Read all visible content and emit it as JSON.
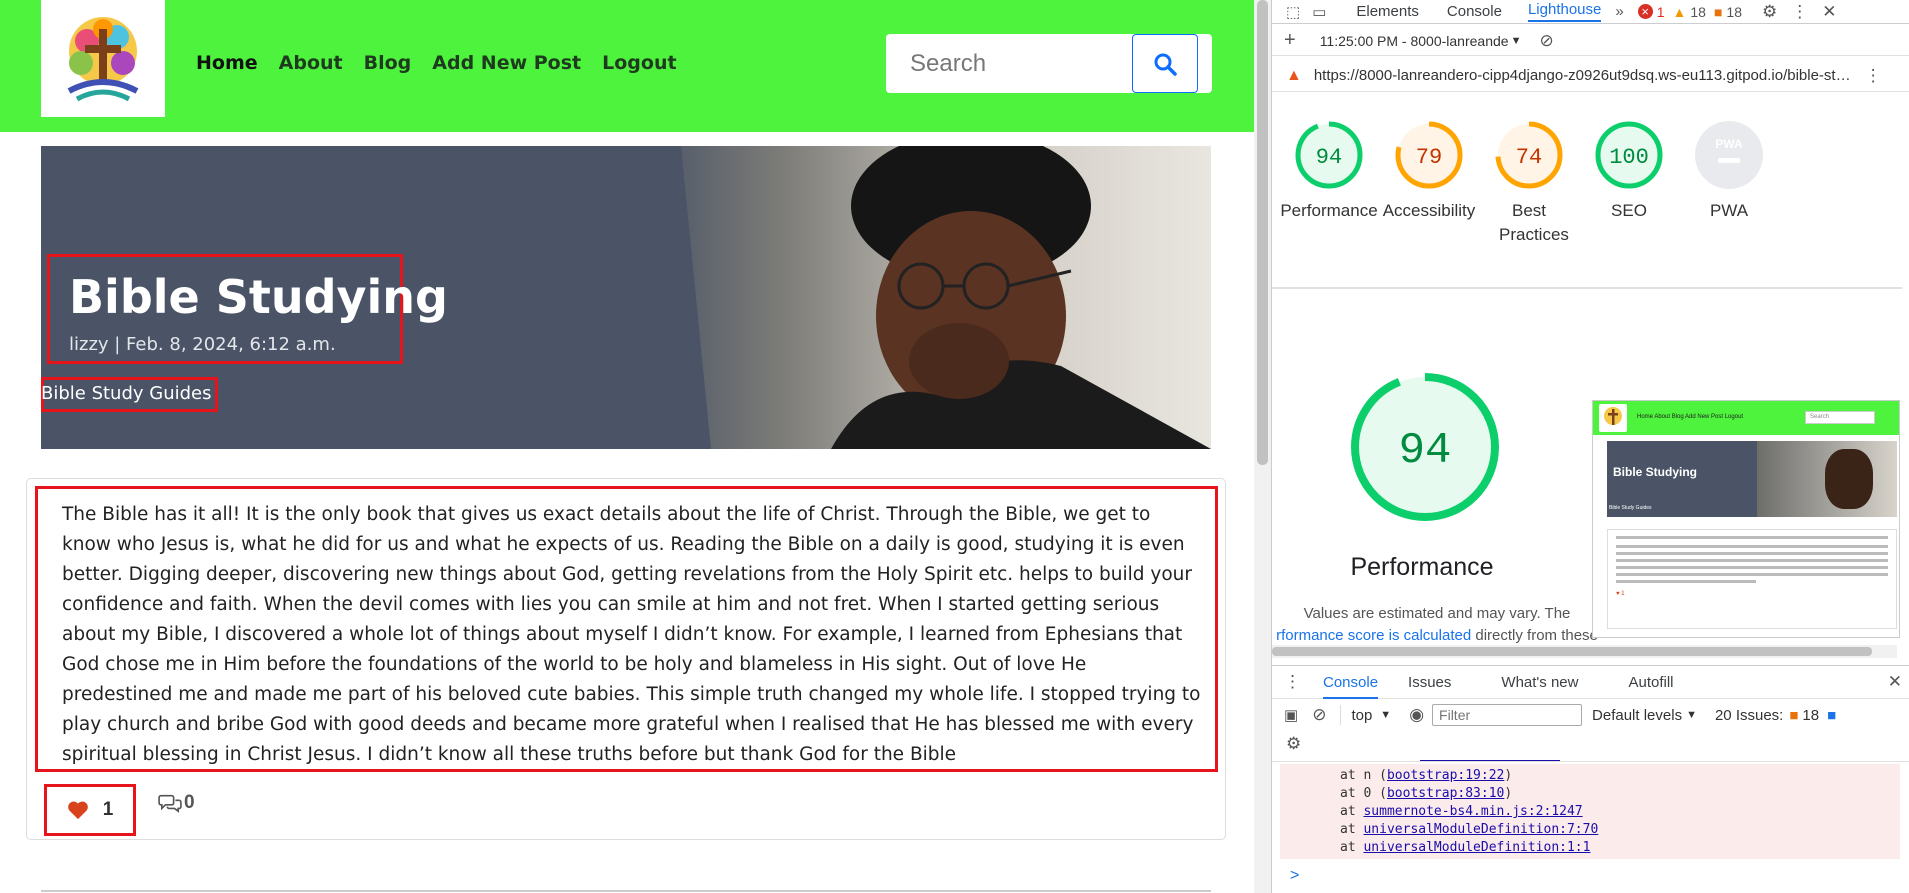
{
  "nav": {
    "items": [
      "Home",
      "About",
      "Blog",
      "Add New Post",
      "Logout"
    ]
  },
  "search": {
    "placeholder": "Search"
  },
  "hero": {
    "title": "Bible Studying",
    "meta": "lizzy | Feb. 8, 2024, 6:12 a.m.",
    "category": "Bible Study Guides"
  },
  "post": {
    "body": "The Bible has it all! It is the only book that gives us exact details about the life of Christ. Through the Bible, we get to know who Jesus is, what he did for us and what he expects of us. Reading the Bible on a daily is good, studying it is even better. Digging deeper, discovering new things about God, getting revelations from the Holy Spirit etc. helps to build your confidence and faith. When the devil comes with lies you can smile at him and not fret. When I started getting serious about my Bible, I discovered a whole lot of things about myself I didn’t know. For example, I learned from Ephesians that God chose me in Him before the foundations of the world to be holy and blameless in His sight. Out of love He predestined me and made me part of his beloved cute babies. This simple truth changed my whole life. I stopped trying to play church and bribe God with good deeds and became more grateful when I realised that He has blessed me with every spiritual blessing in Christ Jesus. I didn’t know all these truths before but thank God for the Bible",
    "likes": "1",
    "comments": "0"
  },
  "devtools": {
    "tabs": [
      "Elements",
      "Console",
      "Lighthouse"
    ],
    "active_tab": "Lighthouse",
    "errors": "1",
    "warnings": "18",
    "issues": "18",
    "report_time": "11:25:00 PM - 8000-lanreande",
    "url": "https://8000-lanreandero-cipp4django-z0926ut9dsq.ws-eu113.gitpod.io/bible-st…",
    "scores": [
      {
        "label": "Performance",
        "value": "94",
        "color": "#0cce6b"
      },
      {
        "label": "Accessibility",
        "value": "79",
        "color": "#ffa400"
      },
      {
        "label": "Best Practices",
        "value": "74",
        "color": "#ffa400"
      },
      {
        "label": "SEO",
        "value": "100",
        "color": "#0cce6b"
      },
      {
        "label": "PWA",
        "value": "PWA",
        "color": "#9aa0a6"
      }
    ],
    "big_score": "94",
    "big_label": "Performance",
    "note_line1": "Values are estimated and may vary. The",
    "note_link": "rformance score is calculated",
    "note_tail": "directly from these",
    "drawer_tabs": [
      "Console",
      "Issues",
      "What's new",
      "Autofill"
    ],
    "console_context": "top",
    "filter_placeholder": "Filter",
    "levels": "Default levels",
    "issues_count": "20 Issues:",
    "issues_err": "18",
    "stack": [
      {
        "prefix": "at n (",
        "link": "bootstrap:19:22",
        "suffix": ")"
      },
      {
        "prefix": "at 0 (",
        "link": "bootstrap:83:10",
        "suffix": ")"
      },
      {
        "prefix": "at ",
        "link": "summernote-bs4.min.js:2:1247",
        "suffix": ""
      },
      {
        "prefix": "at ",
        "link": "universalModuleDefinition:7:70",
        "suffix": ""
      },
      {
        "prefix": "at ",
        "link": "universalModuleDefinition:1:1",
        "suffix": ""
      }
    ],
    "prompt": ">"
  },
  "thumb": {
    "title": "Bible Studying",
    "nav": "Home   About   Blog   Add New Post   Logout",
    "search": "Search",
    "category": "Bible Study Guides"
  }
}
